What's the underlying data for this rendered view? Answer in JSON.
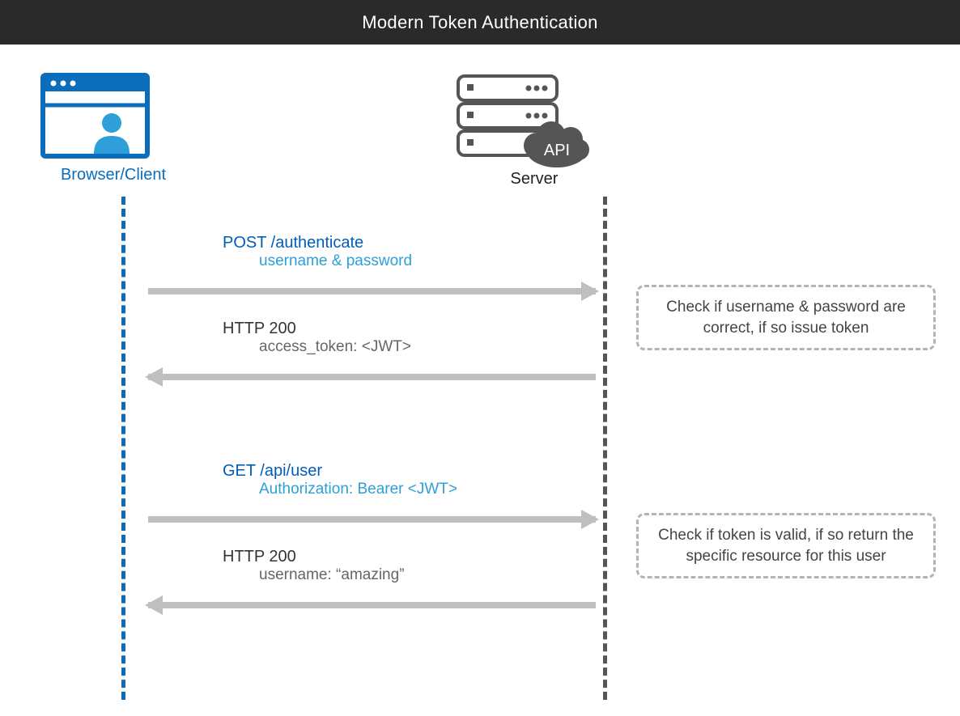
{
  "header": {
    "title": "Modern Token Authentication"
  },
  "participants": {
    "client": {
      "label": "Browser/Client"
    },
    "server": {
      "label": "Server",
      "api_badge": "API"
    }
  },
  "messages": [
    {
      "direction": "right",
      "line1": "POST /authenticate",
      "line2": "username & password",
      "style": "request"
    },
    {
      "direction": "left",
      "line1": "HTTP 200",
      "line2": "access_token: <JWT>",
      "style": "response"
    },
    {
      "direction": "right",
      "line1": "GET /api/user",
      "line2": "Authorization: Bearer <JWT>",
      "style": "request"
    },
    {
      "direction": "left",
      "line1": "HTTP 200",
      "line2": "username: “amazing”",
      "style": "response"
    }
  ],
  "notes": [
    {
      "text": "Check if username & password are correct, if so issue token"
    },
    {
      "text": "Check if token is valid, if so return the specific resource for this user"
    }
  ]
}
